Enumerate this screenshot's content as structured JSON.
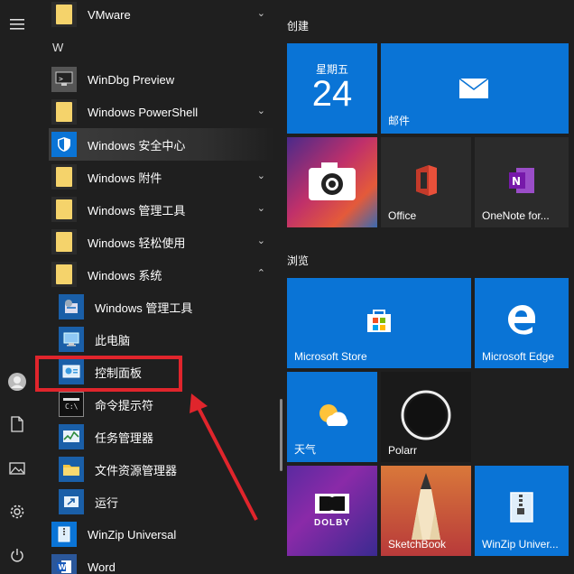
{
  "applist": {
    "letter_w": "W",
    "items": [
      {
        "label": "VMware",
        "type": "folder",
        "expand": "⌄"
      },
      {
        "label": "WinDbg Preview",
        "type": "app"
      },
      {
        "label": "Windows PowerShell",
        "type": "folder",
        "expand": "⌄"
      },
      {
        "label": "Windows 安全中心",
        "type": "app"
      },
      {
        "label": "Windows 附件",
        "type": "folder",
        "expand": "⌄"
      },
      {
        "label": "Windows 管理工具",
        "type": "folder",
        "expand": "⌄"
      },
      {
        "label": "Windows 轻松使用",
        "type": "folder",
        "expand": "⌄"
      },
      {
        "label": "Windows 系统",
        "type": "folder",
        "expand": "⌃"
      }
    ],
    "subitems": [
      {
        "label": "Windows 管理工具"
      },
      {
        "label": "此电脑"
      },
      {
        "label": "控制面板"
      },
      {
        "label": "命令提示符"
      },
      {
        "label": "任务管理器"
      },
      {
        "label": "文件资源管理器"
      },
      {
        "label": "运行"
      }
    ],
    "tail": [
      {
        "label": "WinZip Universal"
      },
      {
        "label": "Word"
      }
    ]
  },
  "groups": {
    "create": "创建",
    "browse": "浏览"
  },
  "tiles": {
    "calendar_weekday": "星期五",
    "calendar_day": "24",
    "mail": "邮件",
    "office": "Office",
    "onenote": "OneNote for...",
    "store": "Microsoft Store",
    "edge": "Microsoft Edge",
    "weather": "天气",
    "polarr": "Polarr",
    "dolby_text": "DOLBY",
    "sketchbook": "SketchBook",
    "winzip": "WinZip Univer..."
  },
  "colors": {
    "accent": "#0a74d6",
    "highlight_box": "#e0252c",
    "folder": "#f5d36b"
  }
}
